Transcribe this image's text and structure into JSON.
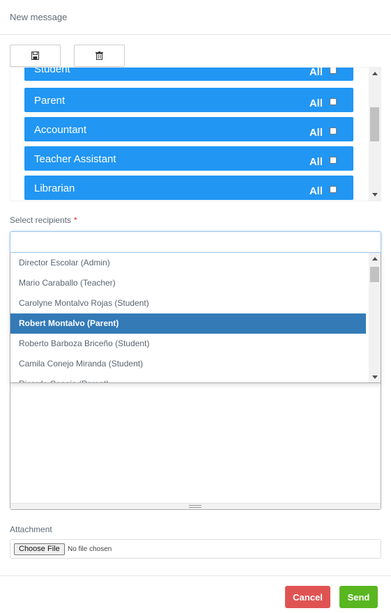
{
  "header": {
    "title": "New message"
  },
  "toolbar": {
    "save_icon": "save-icon",
    "delete_icon": "trash-icon"
  },
  "roles": {
    "items": [
      {
        "label": "Student",
        "all_label": "All",
        "checked": false
      },
      {
        "label": "Parent",
        "all_label": "All",
        "checked": false
      },
      {
        "label": "Accountant",
        "all_label": "All",
        "checked": false
      },
      {
        "label": "Teacher Assistant",
        "all_label": "All",
        "checked": false
      },
      {
        "label": "Librarian",
        "all_label": "All",
        "checked": false
      }
    ],
    "row_color": "#2196f3"
  },
  "recipients": {
    "label": "Select recipients",
    "required_mark": "*",
    "search_value": "",
    "options": [
      "Director Escolar (Admin)",
      "Mario Caraballo (Teacher)",
      "Carolyne Montalvo Rojas (Student)",
      "Robert Montalvo (Parent)",
      "Roberto Barboza Briceño (Student)",
      "Camila Conejo Miranda (Student)",
      "Ricardo Conejo (Parent)"
    ],
    "highlighted": "Robert Montalvo (Parent)",
    "highlight_color": "#337ab7"
  },
  "attachment": {
    "label": "Attachment",
    "button_label": "Choose File",
    "status": "No file chosen"
  },
  "footer": {
    "cancel_label": "Cancel",
    "send_label": "Send",
    "cancel_color": "#e05353",
    "send_color": "#59b620"
  }
}
